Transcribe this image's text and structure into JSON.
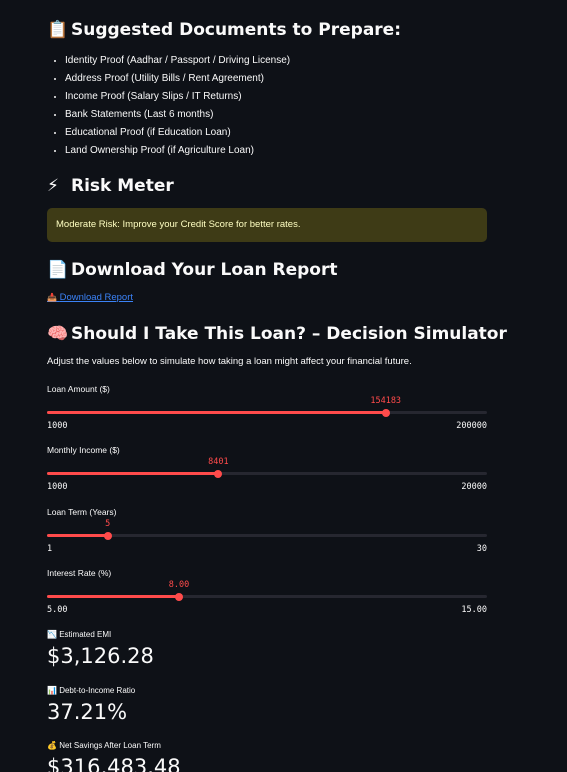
{
  "documents": {
    "icon": "📋",
    "title": "Suggested Documents to Prepare:",
    "items": [
      "Identity Proof (Aadhar / Passport / Driving License)",
      "Address Proof (Utility Bills / Rent Agreement)",
      "Income Proof (Salary Slips / IT Returns)",
      "Bank Statements (Last 6 months)",
      "Educational Proof (if Education Loan)",
      "Land Ownership Proof (if Agriculture Loan)"
    ]
  },
  "risk": {
    "icon": "⚡",
    "title": "Risk Meter",
    "message": "Moderate Risk: Improve your Credit Score for better rates.",
    "alert_bg": "#3e3b16",
    "alert_text": "#ffffc2"
  },
  "report": {
    "icon": "📄",
    "title": "Download Your Loan Report",
    "link_icon": "📥",
    "link_label": "Download Report"
  },
  "simulator": {
    "icon": "🧠",
    "title": "Should I Take This Loan? – Decision Simulator",
    "description": "Adjust the values below to simulate how taking a loan might affect your financial future.",
    "accent": "#ff4b4b",
    "sliders": [
      {
        "label": "Loan Amount ($)",
        "value": "154183",
        "min": "1000",
        "max": "200000",
        "fraction": 0.7698
      },
      {
        "label": "Monthly Income ($)",
        "value": "8401",
        "min": "1000",
        "max": "20000",
        "fraction": 0.3895
      },
      {
        "label": "Loan Term (Years)",
        "value": "5",
        "min": "1",
        "max": "30",
        "fraction": 0.1379
      },
      {
        "label": "Interest Rate (%)",
        "value": "8.00",
        "min": "5.00",
        "max": "15.00",
        "fraction": 0.3
      }
    ]
  },
  "metrics": [
    {
      "icon": "📉",
      "label": "Estimated EMI",
      "value": "$3,126.28"
    },
    {
      "icon": "📊",
      "label": "Debt-to-Income Ratio",
      "value": "37.21%"
    },
    {
      "icon": "💰",
      "label": "Net Savings After Loan Term",
      "value": "$316,483.48"
    }
  ]
}
